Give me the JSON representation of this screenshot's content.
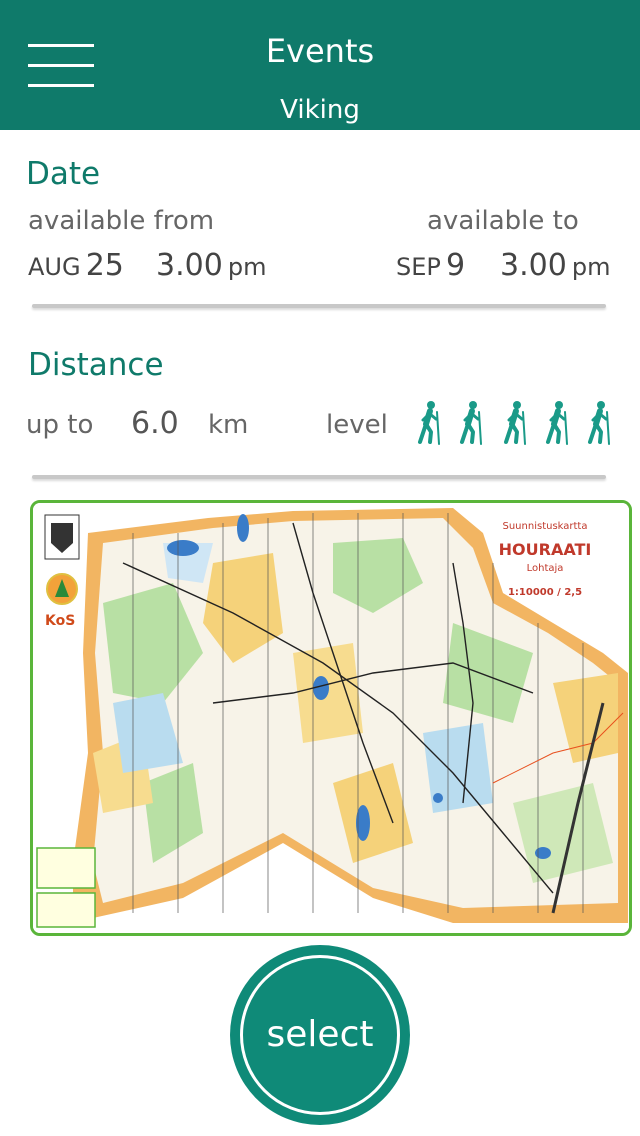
{
  "header": {
    "title": "Events",
    "subtitle": "Viking",
    "menu_icon": "hamburger-menu-icon"
  },
  "date": {
    "section_title": "Date",
    "available_from_label": "available from",
    "available_to_label": "available to",
    "from": {
      "month": "AUG",
      "day": "25",
      "time": "3.00",
      "ampm": "pm"
    },
    "to": {
      "month": "SEP",
      "day": "9",
      "time": "3.00",
      "ampm": "pm"
    }
  },
  "distance": {
    "section_title": "Distance",
    "up_to_label": "up to",
    "value": "6.0",
    "unit": "km",
    "level_label": "level",
    "level_icon": "hiker-icon",
    "level_icon_count": 5
  },
  "map": {
    "title": "Suunnistuskartta",
    "name": "HOURAATI",
    "place": "Lohtaja",
    "scale": "1:10000 / 2,5",
    "club": "KoS"
  },
  "select_label": "select",
  "colors": {
    "primary": "#0f7a6a",
    "map_border": "#5ab53a"
  }
}
